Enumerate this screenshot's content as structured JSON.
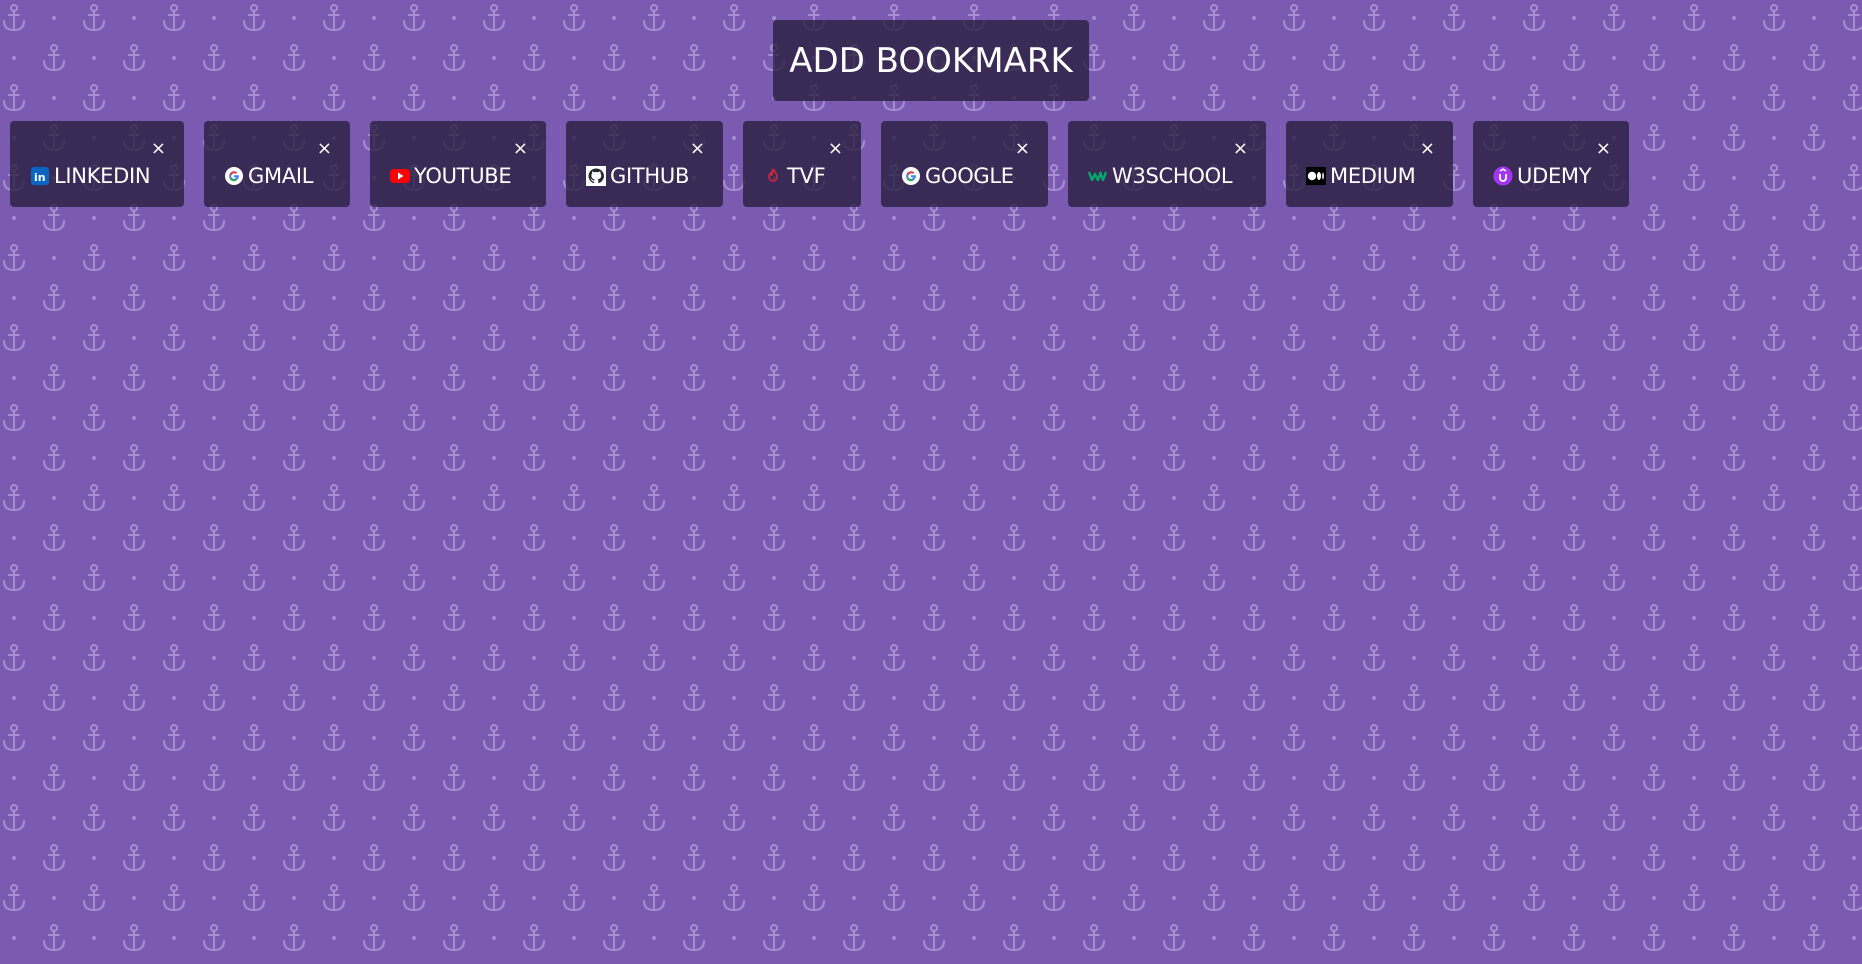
{
  "background_color": "#7b5bb1",
  "add_button": {
    "label": "ADD BOOKMARK"
  },
  "close_glyph": "×",
  "bookmarks": [
    {
      "label": "LINKEDIN",
      "icon": "linkedin-icon"
    },
    {
      "label": "GMAIL",
      "icon": "google-icon"
    },
    {
      "label": "YOUTUBE",
      "icon": "youtube-icon"
    },
    {
      "label": "GITHUB",
      "icon": "github-icon"
    },
    {
      "label": "TVF",
      "icon": "tvf-icon"
    },
    {
      "label": "GOOGLE",
      "icon": "google-icon"
    },
    {
      "label": "W3SCHOOL",
      "icon": "w3schools-icon"
    },
    {
      "label": "MEDIUM",
      "icon": "medium-icon"
    },
    {
      "label": "UDEMY",
      "icon": "udemy-icon"
    }
  ]
}
